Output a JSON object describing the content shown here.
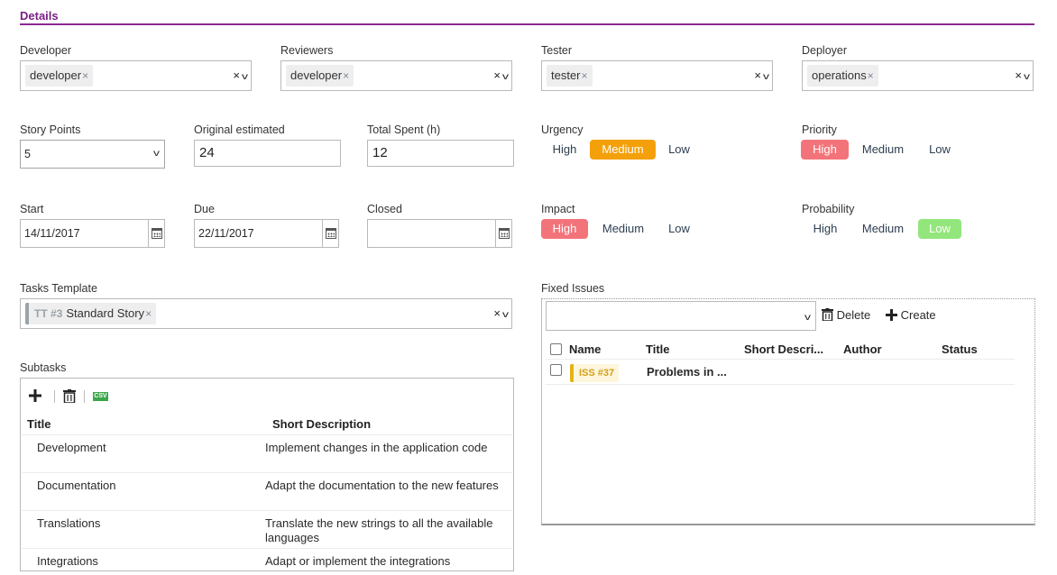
{
  "section": {
    "title": "Details"
  },
  "assignees": [
    {
      "label": "Developer",
      "value": "developer"
    },
    {
      "label": "Reviewers",
      "value": "developer"
    },
    {
      "label": "Tester",
      "value": "tester"
    },
    {
      "label": "Deployer",
      "value": "operations"
    }
  ],
  "chip_remove": "×",
  "clear_glyph": "×",
  "chevron_glyph": "v",
  "estimates": {
    "story_points": {
      "label": "Story Points",
      "value": "5"
    },
    "original": {
      "label": "Original estimated",
      "value": "24"
    },
    "spent": {
      "label": "Total Spent (h)",
      "value": "12"
    }
  },
  "dates": {
    "start": {
      "label": "Start",
      "value": "14/11/2017"
    },
    "due": {
      "label": "Due",
      "value": "22/11/2017"
    },
    "closed": {
      "label": "Closed",
      "value": ""
    }
  },
  "ratings": {
    "urgency": {
      "label": "Urgency",
      "options": [
        "High",
        "Medium",
        "Low"
      ],
      "selected": "Medium"
    },
    "priority": {
      "label": "Priority",
      "options": [
        "High",
        "Medium",
        "Low"
      ],
      "selected": "High"
    },
    "impact": {
      "label": "Impact",
      "options": [
        "High",
        "Medium",
        "Low"
      ],
      "selected": "High"
    },
    "probability": {
      "label": "Probability",
      "options": [
        "High",
        "Medium",
        "Low"
      ],
      "selected": "Low"
    }
  },
  "colors": {
    "accent": "#8a2a92",
    "medium": "#f4a00b",
    "high": "#f2747a",
    "low": "#93e67b",
    "tag": "#e3b21a"
  },
  "tasks_template": {
    "label": "Tasks Template",
    "code": "TT #3",
    "name": "Standard Story"
  },
  "subtasks": {
    "label": "Subtasks",
    "toolbar": {
      "add_icon": "plus-icon",
      "delete_icon": "trash-icon",
      "export_icon": "csv-icon",
      "csv_text": "CSV"
    },
    "columns": [
      "Title",
      "Short Description"
    ],
    "rows": [
      {
        "title": "Development",
        "description": "Implement changes in the application code"
      },
      {
        "title": "Documentation",
        "description": "Adapt the documentation to the new features"
      },
      {
        "title": "Translations",
        "description": "Translate the new strings to all the available languages"
      },
      {
        "title": "Integrations",
        "description": "Adapt or implement the integrations"
      }
    ]
  },
  "fixed_issues": {
    "label": "Fixed Issues",
    "delete_label": "Delete",
    "create_label": "Create",
    "columns": [
      "Name",
      "Title",
      "Short Descri...",
      "Author",
      "Status"
    ],
    "rows": [
      {
        "name": "ISS #37",
        "title": "Problems in ..."
      }
    ]
  }
}
